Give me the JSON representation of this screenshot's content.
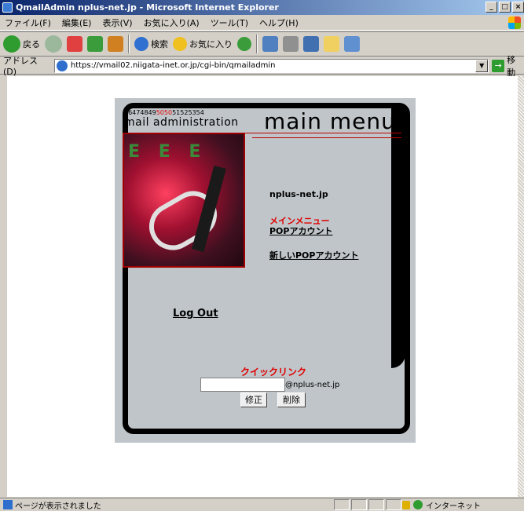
{
  "window": {
    "title": "QmailAdmin nplus-net.jp - Microsoft Internet Explorer",
    "buttons": [
      "_",
      "□",
      "×"
    ]
  },
  "menubar": {
    "items": [
      "ファイル(F)",
      "編集(E)",
      "表示(V)",
      "お気に入り(A)",
      "ツール(T)",
      "ヘルプ(H)"
    ]
  },
  "toolbar": {
    "back_label": "戻る",
    "search_label": "検索",
    "favorites_label": "お気に入り"
  },
  "address": {
    "label": "アドレス(D)",
    "url": "https://vmail02.niigata-inet.or.jp/cgi-bin/qmailadmin",
    "go_label": "移動"
  },
  "page": {
    "numbers_prefix": "46474849",
    "numbers_red": "5050",
    "numbers_suffix": "51525354",
    "subtitle": "mail administration",
    "heading": "main menu",
    "domain": "nplus-net.jp",
    "current_menu": "メインメニュー",
    "link_pop": "POPアカウント",
    "link_new_pop": "新しいPOPアカウント",
    "logout": "Log Out",
    "quicklink_title": "クイックリンク",
    "quicklink_suffix": "@nplus-net.jp",
    "quicklink_value": "",
    "edit_button": "修正",
    "delete_button": "削除"
  },
  "status": {
    "text": "ページが表示されました",
    "zone": "インターネット"
  }
}
